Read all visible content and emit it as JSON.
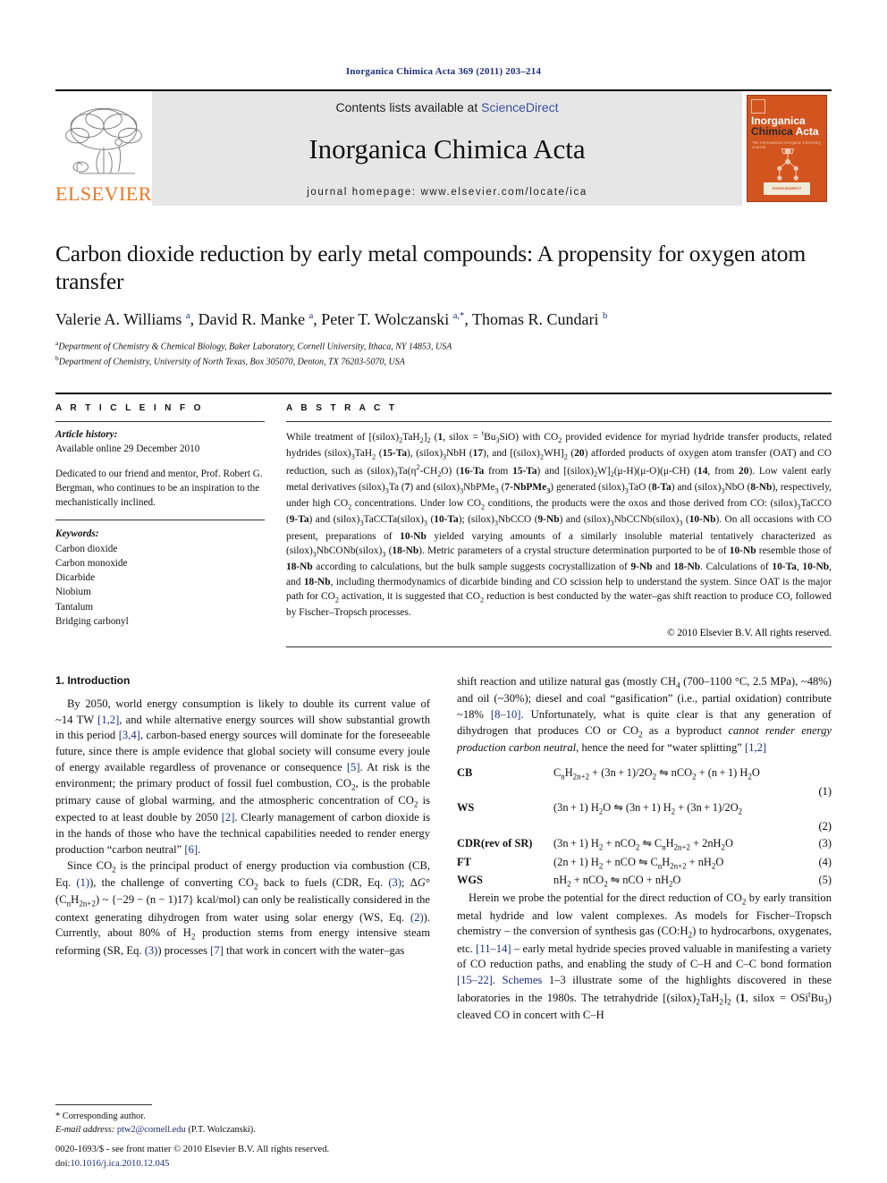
{
  "running_head": "Inorganica Chimica Acta 369 (2011) 203–214",
  "journal_header": {
    "contents_prefix": "Contents lists available at ",
    "contents_link": "ScienceDirect",
    "journal_name": "Inorganica Chimica Acta",
    "homepage": "journal homepage: www.elsevier.com/locate/ica",
    "publisher_logo_text": "ELSEVIER",
    "cover": {
      "line1": "Inorganica",
      "line2a": "Chimica",
      "line2b": "Acta",
      "subtitle": "The International Inorganic Chemistry Journal",
      "footer_badge": "SCIENCEDIRECT"
    },
    "accent_orange": "#e87722",
    "link_blue": "#3b4fa0",
    "band_gray": "#e6e6e6"
  },
  "article": {
    "title": "Carbon dioxide reduction by early metal compounds: A propensity for oxygen atom transfer",
    "authors_html": "Valerie A. Williams <sup>a</sup>, David R. Manke <sup>a</sup>, Peter T. Wolczanski <sup>a,*</sup>, Thomas R. Cundari <sup>b</sup>",
    "affiliations": [
      {
        "marker": "a",
        "text": "Department of Chemistry & Chemical Biology, Baker Laboratory, Cornell University, Ithaca, NY 14853, USA"
      },
      {
        "marker": "b",
        "text": "Department of Chemistry, University of North Texas, Box 305070, Denton, TX 76203-5070, USA"
      }
    ]
  },
  "article_info": {
    "heading": "A R T I C L E   I N F O",
    "history_label": "Article history:",
    "history_value": "Available online 29 December 2010",
    "dedication": "Dedicated to our friend and mentor, Prof. Robert G. Bergman, who continues to be an inspiration to the mechanistically inclined.",
    "keywords_label": "Keywords:",
    "keywords": [
      "Carbon dioxide",
      "Carbon monoxide",
      "Dicarbide",
      "Niobium",
      "Tantalum",
      "Bridging carbonyl"
    ]
  },
  "abstract": {
    "heading": "A B S T R A C T",
    "body_html": "While treatment of [(silox)<sub>2</sub>TaH<sub>2</sub>]<sub>2</sub> (<b>1</b>, silox&nbsp;=&nbsp;<sup>t</sup>Bu<sub>3</sub>SiO) with CO<sub>2</sub> provided evidence for myriad hydride transfer products, related hydrides (silox)<sub>3</sub>TaH<sub>2</sub> (<b>15-Ta</b>), (silox)<sub>3</sub>NbH (<b>17</b>), and [(silox)<sub>2</sub>WH]<sub>2</sub> (<b>20</b>) afforded products of oxygen atom transfer (OAT) and CO reduction, such as (silox)<sub>3</sub>Ta(&eta;<sup>2</sup>-CH<sub>2</sub>O) (<b>16-Ta</b> from <b>15-Ta</b>) and [(silox)<sub>2</sub>W]<sub>2</sub>(&mu;-H)(&mu;-O)(&mu;-CH) (<b>14</b>, from <b>20</b>). Low valent early metal derivatives (silox)<sub>3</sub>Ta (<b>7</b>) and (silox)<sub>3</sub>NbPMe<sub>3</sub> (<b>7-NbPMe<sub>3</sub></b>) generated (silox)<sub>3</sub>TaO (<b>8-Ta</b>) and (silox)<sub>3</sub>NbO (<b>8-Nb</b>), respectively, under high CO<sub>2</sub> concentrations. Under low CO<sub>2</sub> conditions, the products were the oxos and those derived from CO: (silox)<sub>3</sub>TaCCO (<b>9-Ta</b>) and (silox)<sub>3</sub>TaCCTa(silox)<sub>3</sub> (<b>10-Ta</b>); (silox)<sub>3</sub>NbCCO (<b>9-Nb</b>) and (silox)<sub>3</sub>NbCCNb(silox)<sub>3</sub> (<b>10-Nb</b>). On all occasions with CO present, preparations of <b>10-Nb</b> yielded varying amounts of a similarly insoluble material tentatively characterized as (silox)<sub>3</sub>NbCONb(silox)<sub>3</sub> (<b>18-Nb</b>). Metric parameters of a crystal structure determination purported to be of <b>10-Nb</b> resemble those of <b>18-Nb</b> according to calculations, but the bulk sample suggests cocrystallization of <b>9-Nb</b> and <b>18-Nb</b>. Calculations of <b>10-Ta</b>, <b>10-Nb</b>, and <b>18-Nb</b>, including thermodynamics of dicarbide binding and CO scission help to understand the system. Since OAT is the major path for CO<sub>2</sub> activation, it is suggested that CO<sub>2</sub> reduction is best conducted by the water&ndash;gas shift reaction to produce CO, followed by Fischer&ndash;Tropsch processes.",
    "copyright": "© 2010 Elsevier B.V. All rights reserved."
  },
  "intro": {
    "heading": "1. Introduction",
    "left_p1_html": "By 2050, world energy consumption is likely to double its current value of ~14&nbsp;TW <span class=\"lnk\">[1,2]</span>, and while alternative energy sources will show substantial growth in this period <span class=\"lnk\">[3,4]</span>, carbon-based energy sources will dominate for the foreseeable future, since there is ample evidence that global society will consume every joule of energy available regardless of provenance or consequence <span class=\"lnk\">[5]</span>. At risk is the environment; the primary product of fossil fuel combustion, CO<sub>2</sub>, is the probable primary cause of global warming, and the atmospheric concentration of CO<sub>2</sub> is expected to at least double by 2050 <span class=\"lnk\">[2]</span>. Clearly management of carbon dioxide is in the hands of those who have the technical capabilities needed to render energy production &ldquo;carbon neutral&rdquo; <span class=\"lnk\">[6]</span>.",
    "left_p2_html": "Since CO<sub>2</sub> is the principal product of energy production via combustion (CB, Eq. <span class=\"lnk\">(1)</span>), the challenge of converting CO<sub>2</sub> back to fuels (CDR, Eq. <span class=\"lnk\">(3)</span>; &Delta;<i>G</i>&deg;(C<sub>n</sub>H<sub>2n+2</sub>) ~ {&minus;29 &minus; (n &minus; 1)17} kcal/mol) can only be realistically considered in the context generating dihydrogen from water using solar energy (WS, Eq. <span class=\"lnk\">(2)</span>). Currently, about 80% of H<sub>2</sub> production stems from energy intensive steam reforming (SR, Eq. <span class=\"lnk\">(3)</span>) processes <span class=\"lnk\">[7]</span> that work in concert with the water&ndash;gas",
    "right_p1_html": "shift reaction and utilize natural gas (mostly CH<sub>4</sub> (700&ndash;1100&nbsp;&deg;C, 2.5&nbsp;MPa), ~48%) and oil (~30%); diesel and coal &ldquo;gasification&rdquo; (i.e., partial oxidation) contribute ~18% <span class=\"lnk\">[8&ndash;10]</span>. Unfortunately, what is quite clear is that any generation of dihydrogen that produces CO or CO<sub>2</sub> as a byproduct <i>cannot render energy production carbon neutral</i>, hence the need for &ldquo;water splitting&rdquo; <span class=\"lnk\">[1,2]</span>",
    "right_p2_html": "Herein we probe the potential for the direct reduction of CO<sub>2</sub> by early transition metal hydride and low valent complexes. As models for Fischer&ndash;Tropsch chemistry &ndash; the conversion of synthesis gas (CO:H<sub>2</sub>) to hydrocarbons, oxygenates, etc. <span class=\"lnk\">[11&ndash;14]</span> &ndash; early metal hydride species proved valuable in manifesting a variety of CO reduction paths, and enabling the study of C&ndash;H and C&ndash;C bond formation <span class=\"lnk\">[15&ndash;22]</span>. <span class=\"lnk\">Schemes</span> 1&ndash;3 illustrate some of the highlights discovered in these laboratories in the 1980s. The tetrahydride [(silox)<sub>2</sub>TaH<sub>2</sub>]<sub>2</sub> (<b>1</b>, silox&nbsp;=&nbsp;OSi<sup>t</sup>Bu<sub>3</sub>) cleaved CO in concert with C&ndash;H"
  },
  "equations": [
    {
      "label": "CB",
      "body_html": "C<sub>n</sub>H<sub>2n+2</sub> + (3n&thinsp;+&thinsp;1)/2O<sub>2</sub> &#8651; nCO<sub>2</sub> + (n&thinsp;+&thinsp;1) H<sub>2</sub>O",
      "number": "(1)",
      "number_below": true
    },
    {
      "label": "WS",
      "body_html": "(3n&thinsp;+&thinsp;1) H<sub>2</sub>O &#8651; (3n&thinsp;+&thinsp;1) H<sub>2</sub> + (3n&thinsp;+&thinsp;1)/2O<sub>2</sub>",
      "number": "(2)",
      "number_below": true
    },
    {
      "label": "CDR(rev of SR)",
      "body_html": "(3n&thinsp;+&thinsp;1) H<sub>2</sub> + nCO<sub>2</sub> &#8651; C<sub>n</sub>H<sub>2n+2</sub> + 2nH<sub>2</sub>O",
      "number": "(3)",
      "number_below": false
    },
    {
      "label": "FT",
      "body_html": "(2n&thinsp;+&thinsp;1) H<sub>2</sub> + nCO &#8651; C<sub>n</sub>H<sub>2n+2</sub> + nH<sub>2</sub>O",
      "number": "(4)",
      "number_below": false
    },
    {
      "label": "WGS",
      "body_html": "nH<sub>2</sub> + nCO<sub>2</sub> &#8651; nCO + nH<sub>2</sub>O",
      "number": "(5)",
      "number_below": false
    }
  ],
  "footnotes": {
    "corresponding": "* Corresponding author.",
    "email_label": "E-mail address:",
    "email": "ptw2@cornell.edu",
    "email_suffix": "(P.T. Wolczanski).",
    "issn_line": "0020-1693/$ - see front matter © 2010 Elsevier B.V. All rights reserved.",
    "doi_label": "doi:",
    "doi": "10.1016/j.ica.2010.12.045"
  }
}
